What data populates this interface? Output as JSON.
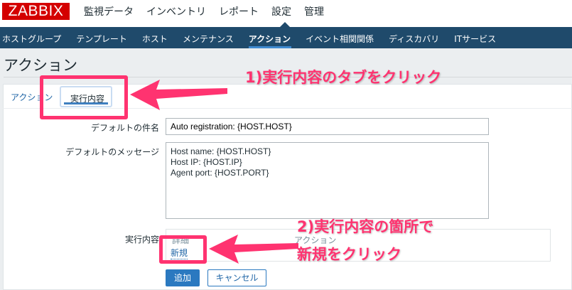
{
  "logo": "ZABBIX",
  "main_nav": [
    "監視データ",
    "インベントリ",
    "レポート",
    "設定",
    "管理"
  ],
  "sub_nav": [
    "ホストグループ",
    "テンプレート",
    "ホスト",
    "メンテナンス",
    "アクション",
    "イベント相関関係",
    "ディスカバリ",
    "ITサービス"
  ],
  "page_title": "アクション",
  "tabs": {
    "action": "アクション",
    "operations": "実行内容"
  },
  "form": {
    "subject_label": "デフォルトの件名",
    "subject_value": "Auto registration: {HOST.HOST}",
    "message_label": "デフォルトのメッセージ",
    "message_value": "Host name: {HOST.HOST}\nHost IP: {HOST.IP}\nAgent port: {HOST.PORT}",
    "operations_label": "実行内容",
    "col_details": "詳細",
    "col_action": "アクション",
    "new_link": "新規",
    "add_button": "追加",
    "cancel_button": "キャンセル"
  },
  "annotations": {
    "step1": "1)実行内容のタブをクリック",
    "step2_line1": "2)実行内容の箇所で",
    "step2_line2": "新規をクリック",
    "color": "#ff3370"
  }
}
